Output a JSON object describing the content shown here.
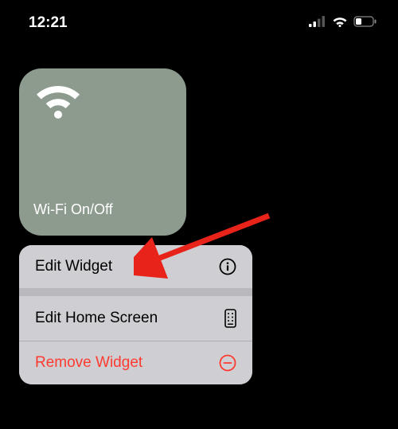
{
  "status": {
    "time": "12:21"
  },
  "widget": {
    "label": "Wi-Fi On/Off"
  },
  "menu": {
    "edit_widget": "Edit Widget",
    "edit_home": "Edit Home Screen",
    "remove": "Remove Widget"
  },
  "colors": {
    "destructive": "#ff3b30",
    "widget_bg": "#8d9b8e"
  }
}
